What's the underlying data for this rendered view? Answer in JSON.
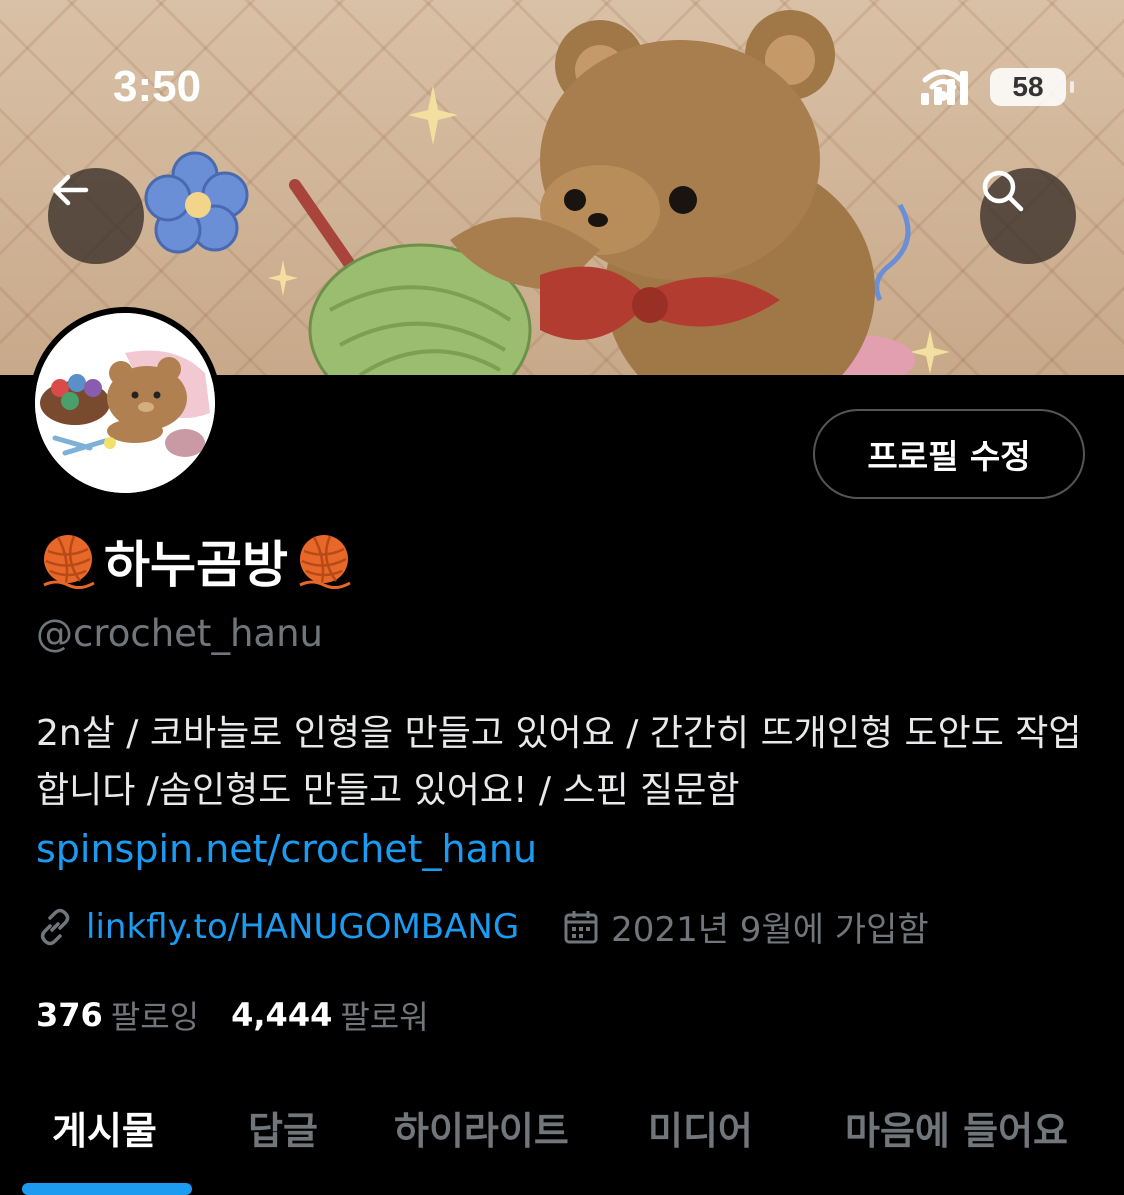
{
  "status_bar": {
    "time": "3:50",
    "battery": "58"
  },
  "profile": {
    "display_name": "하누곰방",
    "handle": "@crochet_hanu",
    "edit_button": "프로필 수정",
    "bio": "2n살 / 코바늘로 인형을 만들고 있어요 / 간간히 뜨개인형 도안도 작업합니다 /솜인형도 만들고 있어요! / 스핀 질문함",
    "bio_link": "spinspin.net/crochet_hanu",
    "website": "linkfly.to/HANUGOMBANG",
    "joined": "2021년 9월에 가입함",
    "following_count": "376",
    "following_label": "팔로잉",
    "followers_count": "4,444",
    "followers_label": "팔로워"
  },
  "tabs": [
    {
      "label": "게시물",
      "active": true
    },
    {
      "label": "답글",
      "active": false
    },
    {
      "label": "하이라이트",
      "active": false
    },
    {
      "label": "미디어",
      "active": false
    },
    {
      "label": "마음에 들어요",
      "active": false
    }
  ],
  "colors": {
    "accent": "#1d9bf0",
    "muted": "#71767b",
    "background": "#000000"
  },
  "icons": [
    "back-arrow-icon",
    "search-icon",
    "link-icon",
    "calendar-icon",
    "yarn-ball-icon"
  ]
}
